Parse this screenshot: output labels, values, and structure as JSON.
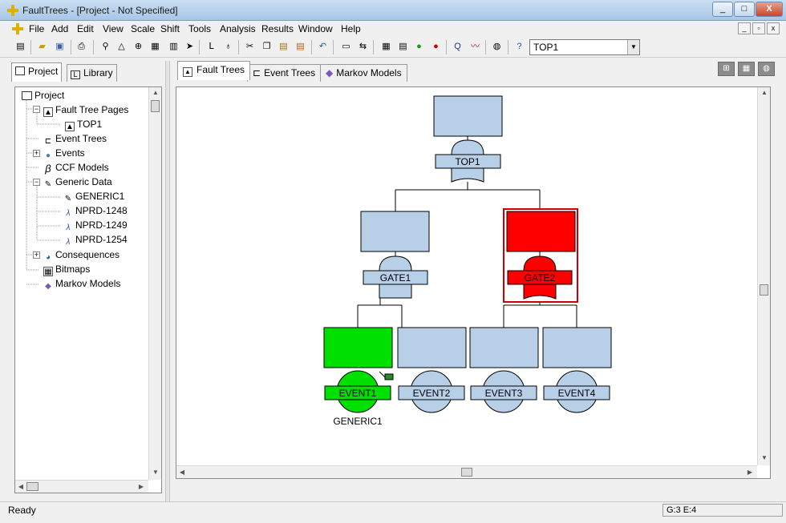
{
  "window": {
    "title": "FaultTrees - [Project - Not Specified]",
    "minimize": "_",
    "maximize": "□",
    "close": "X"
  },
  "menu": [
    "File",
    "Add",
    "Edit",
    "View",
    "Scale",
    "Shift",
    "Tools",
    "Analysis",
    "Results",
    "Window",
    "Help"
  ],
  "mdi_controls": [
    "_",
    "▫",
    "x"
  ],
  "toolbar": {
    "top_combo_value": "TOP1",
    "icons": [
      "properties-icon",
      "open-icon",
      "save-icon",
      "print-icon",
      "add-gate-icon",
      "add-event-icon",
      "add-transfer-icon",
      "add-bitmap-icon",
      "select-icon",
      "logic-icon",
      "undo-link-icon",
      "cut-icon",
      "copy-icon",
      "paste-icon",
      "paste-special-icon",
      "undo-icon",
      "view-page-icon",
      "zoom-fit-icon",
      "calculator-icon",
      "results-icon",
      "traffic-light-icon",
      "stop-icon",
      "query-icon",
      "trend-icon",
      "globe-icon",
      "help-icon"
    ]
  },
  "left_tabs": [
    "Project",
    "Library"
  ],
  "tree": {
    "root": "Project",
    "items": [
      {
        "label": "Fault Tree Pages",
        "level": 1,
        "expander": "−",
        "icon": "fault-tree-pages-icon"
      },
      {
        "label": "TOP1",
        "level": 2,
        "expander": "",
        "icon": "page-icon"
      },
      {
        "label": "Event Trees",
        "level": 1,
        "expander": "",
        "icon": "event-trees-icon"
      },
      {
        "label": "Events",
        "level": 1,
        "expander": "+",
        "icon": "events-icon"
      },
      {
        "label": "CCF Models",
        "level": 1,
        "expander": "",
        "icon": "beta-icon"
      },
      {
        "label": "Generic Data",
        "level": 1,
        "expander": "−",
        "icon": "generic-data-icon"
      },
      {
        "label": "GENERIC1",
        "level": 2,
        "expander": "",
        "icon": "generic-icon"
      },
      {
        "label": "NPRD-1248",
        "level": 2,
        "expander": "",
        "icon": "lambda-icon"
      },
      {
        "label": "NPRD-1249",
        "level": 2,
        "expander": "",
        "icon": "lambda-icon"
      },
      {
        "label": "NPRD-1254",
        "level": 2,
        "expander": "",
        "icon": "lambda-icon"
      },
      {
        "label": "Consequences",
        "level": 1,
        "expander": "+",
        "icon": "consequences-icon"
      },
      {
        "label": "Bitmaps",
        "level": 1,
        "expander": "",
        "icon": "bitmaps-icon"
      },
      {
        "label": "Markov Models",
        "level": 1,
        "expander": "",
        "icon": "markov-icon"
      }
    ]
  },
  "right_tabs": [
    "Fault Trees",
    "Event Trees",
    "Markov Models"
  ],
  "diagram": {
    "top": {
      "label": "TOP1"
    },
    "gate1": {
      "label": "GATE1"
    },
    "gate2": {
      "label": "GATE2"
    },
    "event1": {
      "label": "EVENT1",
      "sub": "GENERIC1"
    },
    "event2": {
      "label": "EVENT2"
    },
    "event3": {
      "label": "EVENT3"
    },
    "event4": {
      "label": "EVENT4"
    },
    "colors": {
      "normal": "#b8cfe8",
      "selected": "#ff0000",
      "highlight": "#00e000",
      "line": "#000000"
    }
  },
  "status": {
    "message": "Ready",
    "coords": "G:3 E:4"
  }
}
